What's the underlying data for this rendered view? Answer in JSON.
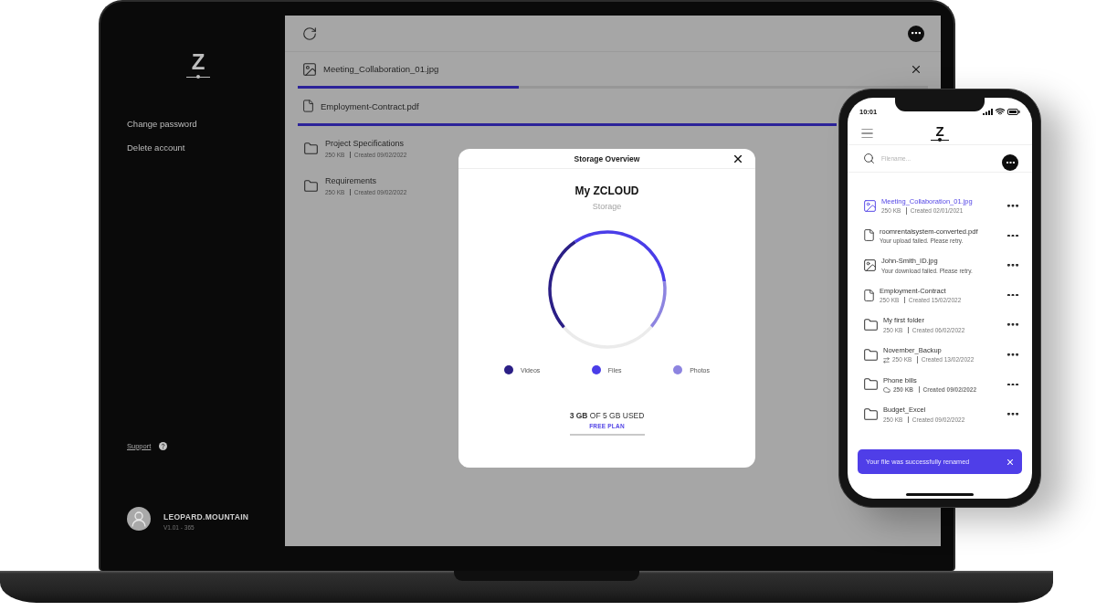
{
  "sidebar": {
    "logo": "Z",
    "links": [
      {
        "label": "Change password"
      },
      {
        "label": "Delete account"
      }
    ],
    "support": "Support",
    "user": {
      "name": "LEOPARD.MOUNTAIN",
      "version": "V1.01 - 365"
    }
  },
  "uploads": [
    {
      "kind": "image",
      "name": "Meeting_Collaboration_01.jpg",
      "level": 0.35
    },
    {
      "kind": "file",
      "name": "Employment-Contract.pdf",
      "level": 1
    }
  ],
  "folders": [
    {
      "name": "Project Specifications",
      "size": "250 KB",
      "created": "Created 09/02/2022"
    },
    {
      "name": "Requirements",
      "size": "250 KB",
      "created": "Created 09/02/2022"
    }
  ],
  "storage_modal": {
    "title": "Storage Overview",
    "heading": "My ZCLOUD",
    "subheading": "Storage",
    "legend": [
      {
        "label": "Videos",
        "color": "#2b1f86"
      },
      {
        "label": "Files",
        "color": "#4a3de8"
      },
      {
        "label": "Photos",
        "color": "#8d84e0"
      }
    ],
    "usage": "**3 GB** OF 5 GB USED",
    "plan": "FREE PLAN"
  },
  "phone": {
    "time": "10:01",
    "logo": "Z",
    "search": {
      "placeholder": "Filename..."
    },
    "files": [
      {
        "kind": "image",
        "name": "Meeting_Collaboration_01.jpg",
        "selected": true,
        "syncing": false,
        "in_cloud": false,
        "size": "250 KB",
        "created": "Created 02/01/2021"
      },
      {
        "kind": "file",
        "name": "roomrentalsystem-converted.pdf",
        "selected": false,
        "syncing": false,
        "in_cloud": false,
        "message": "Your upload failed. Please retry."
      },
      {
        "kind": "image",
        "name": "John-Smith_ID.jpg",
        "selected": false,
        "syncing": false,
        "in_cloud": false,
        "message": "Your download failed. Please retry."
      },
      {
        "kind": "file",
        "name": "Employment-Contract",
        "selected": false,
        "syncing": false,
        "in_cloud": false,
        "size": "250 KB",
        "created": "Created 15/02/2022"
      },
      {
        "kind": "folder",
        "name": "My first folder",
        "selected": false,
        "syncing": false,
        "in_cloud": false,
        "size": "250 KB",
        "created": "Created 06/02/2022"
      },
      {
        "kind": "folder",
        "name": "November_Backup",
        "selected": false,
        "syncing": true,
        "in_cloud": false,
        "size": "250 KB",
        "created": "Created 13/02/2022"
      },
      {
        "kind": "folder",
        "name": "Phone bills",
        "selected": false,
        "syncing": false,
        "in_cloud": true,
        "size": "250 KB",
        "created": "Created 09/02/2022"
      },
      {
        "kind": "folder",
        "name": "Budget_Excel",
        "selected": false,
        "syncing": false,
        "in_cloud": false,
        "size": "250 KB",
        "created": "Created 09/02/2022"
      }
    ],
    "toast": {
      "message": "Your file was successfully renamed"
    }
  }
}
